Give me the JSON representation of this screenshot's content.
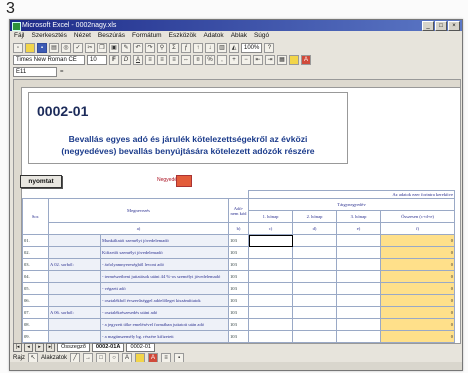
{
  "page_number": "3",
  "window": {
    "title": "Microsoft Excel - 0002nagy.xls",
    "controls": [
      "_",
      "□",
      "×"
    ]
  },
  "menu": [
    "Fájl",
    "Szerkesztés",
    "Nézet",
    "Beszúrás",
    "Formátum",
    "Eszközök",
    "Adatok",
    "Ablak",
    "Súgó"
  ],
  "toolbar": {
    "zoom": "100%",
    "font_name": "Times New Roman CE",
    "font_size": "10"
  },
  "formula_bar": {
    "cell_ref": "E11",
    "fx": "="
  },
  "form": {
    "code": "0002-01",
    "subtitle_line1": "Bevallás egyes adó és járulék kötelezettségekről az évközi",
    "subtitle_line2": "(negyedéves) bevallás benyújtására kötelezett adózók részére",
    "submit_label": "nyomtat",
    "quarter_label": "Negyedév"
  },
  "table": {
    "top_band": "Az adatok ezer forintra kerekítve",
    "col_headers": {
      "sorszam": "Sor.",
      "megnevezes": "Megnevezés",
      "adonem": "Adó-nem kód",
      "adonem_letter": "b)",
      "targynegyedev": "Tárgynegyedév",
      "h1": "1. hónap",
      "h1_letter": "c)",
      "h2": "2. hónap",
      "h2_letter": "d)",
      "h3": "3. hónap",
      "h3_letter": "e)",
      "ossz": "Összesen (c+d+e)",
      "ossz_letter": "f)",
      "a_letter": "a)"
    },
    "rows": [
      {
        "sor": "01.",
        "label": "",
        "desc": "Munkáltatói személyi jövedelemadó",
        "code": "103",
        "h1": "",
        "h2": "",
        "h3": "",
        "tot": "0"
      },
      {
        "sor": "02.",
        "label": "",
        "desc": "Kifizetői személyi jövedelemadó",
        "code": "103",
        "h1": "",
        "h2": "",
        "h3": "",
        "tot": "0"
      },
      {
        "sor": "03.",
        "label": "A 02. sorból:",
        "desc": "- árfolyamnyereségből levont adó",
        "code": "103",
        "h1": "",
        "h2": "",
        "h3": "",
        "tot": "0"
      },
      {
        "sor": "04.",
        "label": "",
        "desc": "- természetbeni juttatások utáni 44 %-os személyi jövedelemadó",
        "code": "103",
        "h1": "",
        "h2": "",
        "h3": "",
        "tot": "0"
      },
      {
        "sor": "05.",
        "label": "",
        "desc": "- végzett adó",
        "code": "103",
        "h1": "",
        "h2": "",
        "h3": "",
        "tot": "0"
      },
      {
        "sor": "06.",
        "label": "",
        "desc": "- osztalékból évszerűséggel adóelőleget kiszámíttatok",
        "code": "103",
        "h1": "",
        "h2": "",
        "h3": "",
        "tot": "0"
      },
      {
        "sor": "07.",
        "label": "A 06. sorból:",
        "desc": "- osztalékrészesedés utáni adó",
        "code": "103",
        "h1": "",
        "h2": "",
        "h3": "",
        "tot": "0"
      },
      {
        "sor": "08.",
        "label": "",
        "desc": "- a jegyzett tőke emelésével formában juttatott után adó",
        "code": "103",
        "h1": "",
        "h2": "",
        "h3": "",
        "tot": "0"
      },
      {
        "sor": "09.",
        "label": "",
        "desc": "- a magánszemély bg. részére kifizetett",
        "code": "103",
        "h1": "",
        "h2": "",
        "h3": "",
        "tot": "0"
      }
    ]
  },
  "sheet_tabs": [
    "Összegző",
    "0002-01A",
    "0002-01"
  ],
  "drawing_bar": {
    "label": "Rajz",
    "autoshapes": "Alakzatok"
  },
  "colors": {
    "title_start": "#1d2a88",
    "title_end": "#5c78c6",
    "form_text": "#1c3c8c",
    "quarter_box": "#e35c3a",
    "total_col": "#ffe08a"
  }
}
